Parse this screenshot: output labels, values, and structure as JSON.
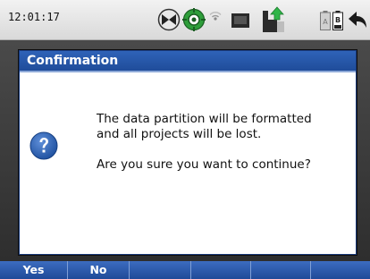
{
  "status_bar": {
    "time": "12:01:17",
    "icons": [
      "satellite-tracking-icon",
      "gps-status-icon",
      "radio-signal-icon",
      "card-storage-icon",
      "data-transfer-icon",
      "battery-a-icon",
      "battery-b-icon",
      "back-arrow-icon"
    ],
    "battery_labels": {
      "a": "A",
      "b": "B"
    }
  },
  "dialog": {
    "title": "Confirmation",
    "icon": "question-icon",
    "message_line1": "The data partition will be formatted",
    "message_line2": "and all projects will be lost.",
    "message_question": "Are you sure you want to continue?"
  },
  "softkeys": {
    "yes_label": "Yes",
    "no_label": "No",
    "empty": [
      "",
      "",
      "",
      ""
    ]
  },
  "colors": {
    "accent": "#2f63b8",
    "frame": "#3a3a3a",
    "green_status": "#2e9e3a"
  }
}
